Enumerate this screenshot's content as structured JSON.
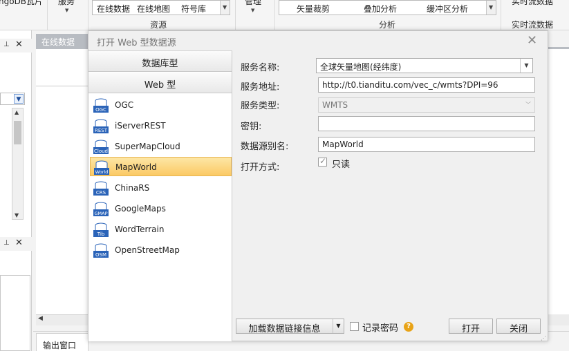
{
  "ribbon": {
    "mongodb_label": "ngoDB瓦片",
    "service_label": "服务",
    "resource_gallery": [
      "在线数据",
      "在线地图",
      "符号库"
    ],
    "resource_group": "资源",
    "manage_label": "管理",
    "analysis_gallery": [
      "矢量裁剪",
      "叠加分析",
      "缓冲区分析"
    ],
    "analysis_group": "分析",
    "realtime_top": "实时流数据",
    "realtime_label": "实时流数据"
  },
  "map_tab": {
    "label": "在线数据"
  },
  "output": {
    "label": "输出窗口"
  },
  "dialog": {
    "title": "打开 Web 型数据源",
    "categories": {
      "database": "数据库型",
      "web": "Web 型"
    },
    "sources": [
      {
        "name": "OGC",
        "icon_text": "OGC"
      },
      {
        "name": "iServerREST",
        "icon_text": "REST"
      },
      {
        "name": "SuperMapCloud",
        "icon_text": "Cloud"
      },
      {
        "name": "MapWorld",
        "icon_text": "World",
        "selected": true
      },
      {
        "name": "ChinaRS",
        "icon_text": "CRS"
      },
      {
        "name": "GoogleMaps",
        "icon_text": "GMAP"
      },
      {
        "name": "WordTerrain",
        "icon_text": "Tib"
      },
      {
        "name": "OpenStreetMap",
        "icon_text": "OSM"
      }
    ],
    "fields": {
      "service_name_label": "服务名称:",
      "service_name_value": "全球矢量地图(经纬度)",
      "service_url_label": "服务地址:",
      "service_url_value": "http://t0.tianditu.com/vec_c/wmts?DPI=96",
      "service_type_label": "服务类型:",
      "service_type_value": "WMTS",
      "key_label": "密钥:",
      "key_value": "",
      "alias_label": "数据源别名:",
      "alias_value": "MapWorld",
      "open_mode_label": "打开方式:",
      "readonly_label": "只读"
    },
    "load_button": "加载数据链接信息",
    "remember_label": "记录密码",
    "open_button": "打开",
    "close_button": "关闭"
  },
  "colors": {
    "selected_bg": "#fbc964",
    "help_icon": "#e8a317",
    "icon_blue": "#2a63b8"
  }
}
